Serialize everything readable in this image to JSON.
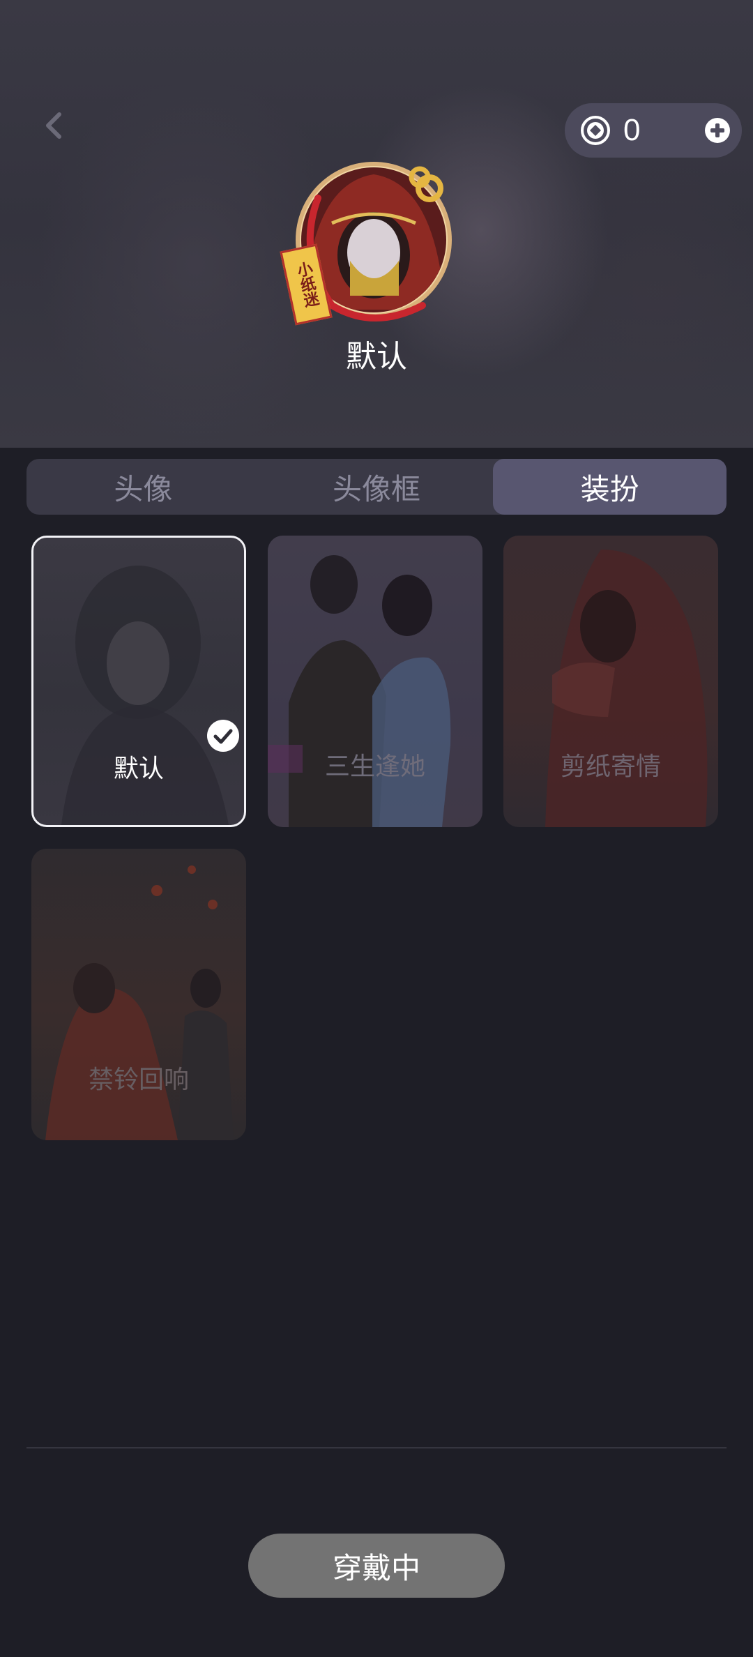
{
  "header": {
    "coin_count": "0",
    "avatar_badge": "小纸迷",
    "avatar_name": "默认"
  },
  "tabs": [
    {
      "label": "头像",
      "active": false
    },
    {
      "label": "头像框",
      "active": false
    },
    {
      "label": "装扮",
      "active": true
    }
  ],
  "outfits": [
    {
      "label": "默认",
      "selected": true
    },
    {
      "label": "三生逢她",
      "selected": false
    },
    {
      "label": "剪纸寄情",
      "selected": false
    },
    {
      "label": "禁铃回响",
      "selected": false
    }
  ],
  "footer": {
    "wear_button": "穿戴中"
  }
}
